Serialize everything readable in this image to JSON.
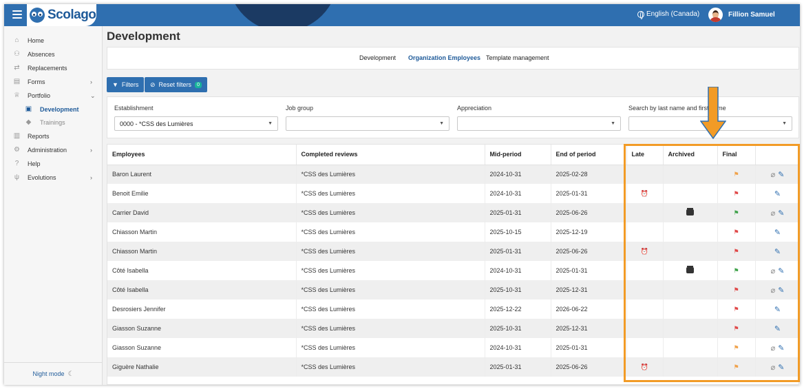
{
  "app": {
    "logo_text": "Scolago"
  },
  "header": {
    "language": "English (Canada)",
    "user_name": "Fillion Samuel"
  },
  "sidebar": {
    "items": [
      {
        "label": "Home",
        "icon": "home-icon"
      },
      {
        "label": "Absences",
        "icon": "absences-icon"
      },
      {
        "label": "Replacements",
        "icon": "replacements-icon"
      },
      {
        "label": "Forms",
        "icon": "forms-icon",
        "chevron": "›"
      },
      {
        "label": "Portfolio",
        "icon": "trophy-icon",
        "chevron": "⌄"
      },
      {
        "label": "Development",
        "icon": "development-icon"
      },
      {
        "label": "Trainings",
        "icon": "graduation-cap-icon"
      },
      {
        "label": "Reports",
        "icon": "reports-icon"
      },
      {
        "label": "Administration",
        "icon": "gear-icon",
        "chevron": "›"
      },
      {
        "label": "Help",
        "icon": "help-icon"
      },
      {
        "label": "Evolutions",
        "icon": "evolutions-icon",
        "chevron": "›"
      }
    ],
    "night_mode": "Night mode"
  },
  "page": {
    "title": "Development"
  },
  "tabs": [
    {
      "label": "Development"
    },
    {
      "label": "Organization Employees",
      "active": true
    },
    {
      "label": "Template management"
    }
  ],
  "toolbar": {
    "filters_label": "Filters",
    "reset_label": "Reset filters",
    "reset_count": "0"
  },
  "filters": {
    "establishment": {
      "label": "Establishment",
      "value": "0000 - *CSS des Lumières"
    },
    "job_group": {
      "label": "Job group",
      "value": ""
    },
    "appreciation": {
      "label": "Appreciation",
      "value": ""
    },
    "search": {
      "label": "Search by last name and first name",
      "value": ""
    }
  },
  "table": {
    "columns": [
      "Employees",
      "Completed reviews",
      "Mid-period",
      "End of period",
      "Late",
      "Archived",
      "Final",
      ""
    ],
    "rows": [
      {
        "employee": "Baron Laurent",
        "review": "*CSS des Lumières",
        "mid": "2024-10-31",
        "end": "2025-02-28",
        "late": false,
        "archived": false,
        "flag": "orange",
        "clip": true
      },
      {
        "employee": "Benoit Emilie",
        "review": "*CSS des Lumières",
        "mid": "2024-10-31",
        "end": "2025-01-31",
        "late": true,
        "archived": false,
        "flag": "red",
        "clip": false
      },
      {
        "employee": "Carrier David",
        "review": "*CSS des Lumières",
        "mid": "2025-01-31",
        "end": "2025-06-26",
        "late": false,
        "archived": true,
        "flag": "green",
        "clip": true
      },
      {
        "employee": "Chiasson Martin",
        "review": "*CSS des Lumières",
        "mid": "2025-10-15",
        "end": "2025-12-19",
        "late": false,
        "archived": false,
        "flag": "red",
        "clip": false
      },
      {
        "employee": "Chiasson Martin",
        "review": "*CSS des Lumières",
        "mid": "2025-01-31",
        "end": "2025-06-26",
        "late": true,
        "archived": false,
        "flag": "red",
        "clip": false
      },
      {
        "employee": "Côté Isabella",
        "review": "*CSS des Lumières",
        "mid": "2024-10-31",
        "end": "2025-01-31",
        "late": false,
        "archived": true,
        "flag": "green",
        "clip": true
      },
      {
        "employee": "Côté Isabella",
        "review": "*CSS des Lumières",
        "mid": "2025-10-31",
        "end": "2025-12-31",
        "late": false,
        "archived": false,
        "flag": "red",
        "clip": true
      },
      {
        "employee": "Desrosiers Jennifer",
        "review": "*CSS des Lumières",
        "mid": "2025-12-22",
        "end": "2026-06-22",
        "late": false,
        "archived": false,
        "flag": "red",
        "clip": false
      },
      {
        "employee": "Giasson Suzanne",
        "review": "*CSS des Lumières",
        "mid": "2025-10-31",
        "end": "2025-12-31",
        "late": false,
        "archived": false,
        "flag": "red",
        "clip": false
      },
      {
        "employee": "Giasson Suzanne",
        "review": "*CSS des Lumières",
        "mid": "2024-10-31",
        "end": "2025-01-31",
        "late": false,
        "archived": false,
        "flag": "orange",
        "clip": true
      },
      {
        "employee": "Giguère Nathalie",
        "review": "*CSS des Lumières",
        "mid": "2025-01-31",
        "end": "2025-06-26",
        "late": true,
        "archived": false,
        "flag": "orange",
        "clip": true
      }
    ]
  },
  "colors": {
    "primary": "#2f6fb0",
    "highlight": "#f29b26",
    "badge": "#19b49b"
  }
}
